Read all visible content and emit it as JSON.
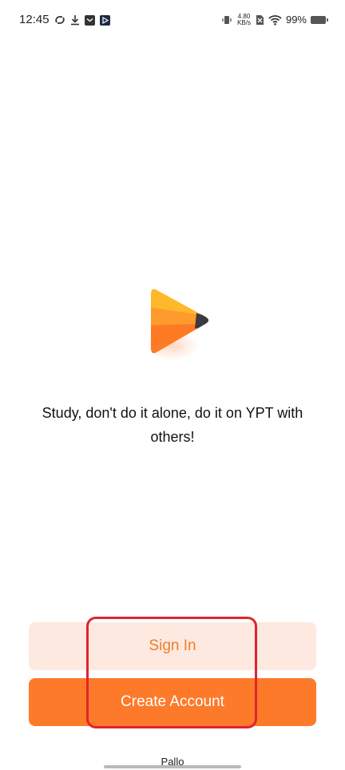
{
  "status_bar": {
    "time": "12:45",
    "left_icons": [
      "sync-icon",
      "download-icon",
      "mail-icon",
      "play-store-icon"
    ],
    "net_speed_value": "4.80",
    "net_speed_unit": "KB/s",
    "right_icons": [
      "vibrate-icon",
      "sim-off-icon",
      "wifi-icon",
      "battery-icon"
    ],
    "battery_percent": "99%"
  },
  "app": {
    "logo_icon": "ypt-play-logo-icon",
    "tagline": "Study, don't do it alone, do it on YPT with others!"
  },
  "buttons": {
    "sign_in": "Sign In",
    "create_account": "Create Account"
  },
  "bottom": {
    "label": "Pallo"
  },
  "colors": {
    "accent": "#fd7a2a",
    "accent_light": "#fde9df",
    "accent_text": "#ee7e2c",
    "annotation": "#e0242d"
  }
}
